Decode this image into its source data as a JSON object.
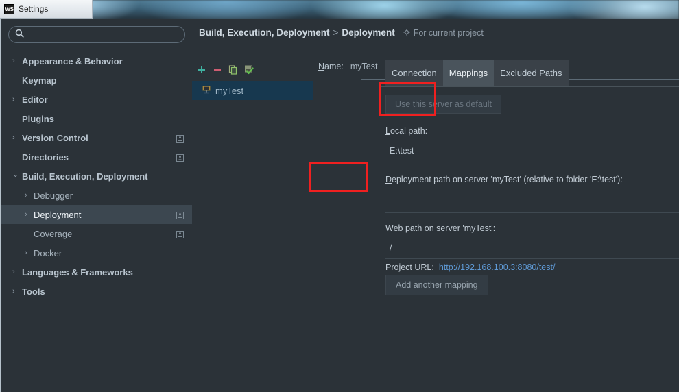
{
  "window": {
    "app_icon_label": "WS",
    "title": "Settings"
  },
  "search": {
    "value": "",
    "placeholder": ""
  },
  "sidebar": {
    "items": [
      {
        "label": "Appearance & Behavior",
        "depth": 0,
        "arrow": "collapsed",
        "bold": true,
        "selected": false,
        "badge": false
      },
      {
        "label": "Keymap",
        "depth": 0,
        "arrow": "none",
        "bold": true,
        "selected": false,
        "badge": false
      },
      {
        "label": "Editor",
        "depth": 0,
        "arrow": "collapsed",
        "bold": true,
        "selected": false,
        "badge": false
      },
      {
        "label": "Plugins",
        "depth": 0,
        "arrow": "none",
        "bold": true,
        "selected": false,
        "badge": false
      },
      {
        "label": "Version Control",
        "depth": 0,
        "arrow": "collapsed",
        "bold": true,
        "selected": false,
        "badge": true
      },
      {
        "label": "Directories",
        "depth": 0,
        "arrow": "none",
        "bold": true,
        "selected": false,
        "badge": true
      },
      {
        "label": "Build, Execution, Deployment",
        "depth": 0,
        "arrow": "expanded",
        "bold": true,
        "selected": false,
        "badge": false
      },
      {
        "label": "Debugger",
        "depth": 1,
        "arrow": "collapsed",
        "bold": false,
        "selected": false,
        "badge": false
      },
      {
        "label": "Deployment",
        "depth": 1,
        "arrow": "collapsed",
        "bold": false,
        "selected": true,
        "badge": true
      },
      {
        "label": "Coverage",
        "depth": 1,
        "arrow": "none",
        "bold": false,
        "selected": false,
        "badge": true
      },
      {
        "label": "Docker",
        "depth": 1,
        "arrow": "collapsed",
        "bold": false,
        "selected": false,
        "badge": false
      },
      {
        "label": "Languages & Frameworks",
        "depth": 0,
        "arrow": "collapsed",
        "bold": true,
        "selected": false,
        "badge": false
      },
      {
        "label": "Tools",
        "depth": 0,
        "arrow": "collapsed",
        "bold": true,
        "selected": false,
        "badge": false
      }
    ]
  },
  "breadcrumb": {
    "root": "Build, Execution, Deployment",
    "separator": ">",
    "leaf": "Deployment",
    "scope": "For current project"
  },
  "server_toolbar": {
    "add_label": "+",
    "remove_label": "−",
    "copy_label": "copy-icon",
    "default_label": "set-default-icon"
  },
  "server_list": {
    "items": [
      {
        "name": "myTest",
        "icon": "remote-host-icon",
        "selected": true
      }
    ]
  },
  "form": {
    "name_label": "Name:",
    "name_mnemonic": "N",
    "name_value": "myTest",
    "tabs": [
      {
        "label": "Connection",
        "active": false
      },
      {
        "label": "Mappings",
        "active": true
      },
      {
        "label": "Excluded Paths",
        "active": false
      }
    ],
    "use_default_button": "Use this server as default",
    "local_path_label": "Local path:",
    "local_path_mnemonic": "L",
    "local_path_value": "E:\\test",
    "deployment_path_label": "Deployment path on server 'myTest' (relative to folder 'E:\\test'):",
    "deployment_path_mnemonic": "D",
    "deployment_path_value": "",
    "web_path_label": "Web path on server 'myTest':",
    "web_path_mnemonic": "W",
    "web_path_value": "/",
    "project_url_label": "Project URL:",
    "project_url_value": "http://192.168.100.3:8080/test/",
    "add_mapping_button": "Add another mapping",
    "add_mapping_mnemonic": "d"
  },
  "annotations": {
    "highlight_tab": "Mappings",
    "highlight_field": "E:\\test",
    "color": "#f02020"
  },
  "colors": {
    "background": "#2b3238",
    "selection": "#3c4750",
    "server_selection": "#17384f",
    "link": "#5f9ad6",
    "accent_green": "#34a893",
    "accent_red": "#d1546a"
  }
}
